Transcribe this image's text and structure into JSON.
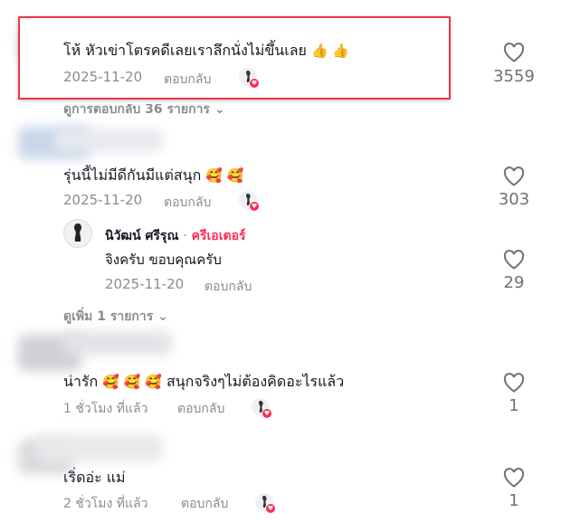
{
  "icons": {
    "like": "heart-outline-icon",
    "chevron": "chevron-down-icon",
    "creator_avatar": "creator-avatar-icon"
  },
  "colors": {
    "highlight_border": "#e63946",
    "creator_tag": "#fe2c55",
    "secondary_text": "#8a8b91"
  },
  "comments": [
    {
      "text": "โห้ หัวเข่าโตรคดีเลยเราลึกนั่งไม่ขึ้นเลย",
      "emoji": "👍 👍",
      "date": "2025-11-20",
      "reply_label": "ตอบกลับ",
      "likes": "3559",
      "view_more": "ดูการตอบกลับ 36 รายการ"
    },
    {
      "text": "รุ่นนี้ไม่มีดีกันมีแต่สนุก",
      "emoji": "🥰 🥰",
      "date": "2025-11-20",
      "reply_label": "ตอบกลับ",
      "likes": "303"
    },
    {
      "text": "น่ารัก",
      "emoji_inline": "🥰 🥰 🥰",
      "text_after": "สนุกจริงๆไม่ต้องคิดอะไรแล้ว",
      "date": "1 ชั่วโมง ที่แล้ว",
      "reply_label": "ตอบกลับ",
      "likes": "1"
    },
    {
      "text": "เริ่ดอ่ะ แม่",
      "date": "2 ชั่วโมง ที่แล้ว",
      "reply_label": "ตอบกลับ",
      "likes": "1"
    }
  ],
  "reply": {
    "author": "นิวัฒน์ ศรีรุณ",
    "separator": "·",
    "creator_label": "ครีเอเตอร์",
    "text": "จิงครับ ขอบคุณครับ",
    "date": "2025-11-20",
    "reply_label": "ตอบกลับ",
    "likes": "29"
  },
  "view_more_replies": "ดูเพิ่ม 1 รายการ"
}
